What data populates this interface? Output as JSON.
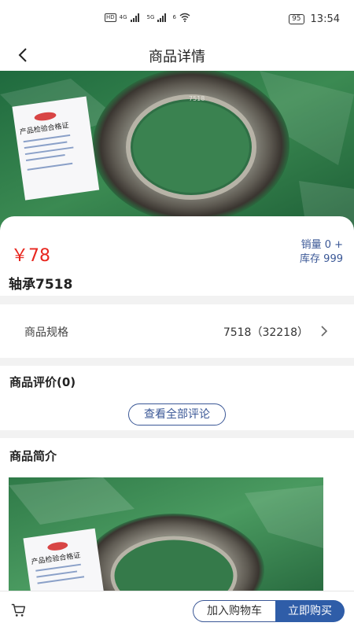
{
  "status_bar": {
    "network_left": "HD",
    "signal_4g": "4G",
    "signal_5g": "5G",
    "wifi_badge": "6",
    "battery": "95",
    "time": "13:54"
  },
  "header": {
    "title": "商品详情",
    "back_icon": "chevron-left-icon"
  },
  "product": {
    "price": "￥78",
    "sales": "销量 0 +",
    "stock": "库存 999",
    "name": "轴承7518",
    "certificate_title": "产品检验合格证",
    "bearing_marking": "7518"
  },
  "spec": {
    "label": "商品规格",
    "value": "7518（32218）"
  },
  "reviews": {
    "title": "商品评价(0)",
    "button": "查看全部评论"
  },
  "intro": {
    "title": "商品简介"
  },
  "bottom_bar": {
    "cart_icon": "cart-icon",
    "add_to_cart": "加入购物车",
    "buy_now": "立即购买"
  },
  "colors": {
    "accent": "#3a5796",
    "price": "#e8271f",
    "buy_button": "#2f5da8"
  }
}
